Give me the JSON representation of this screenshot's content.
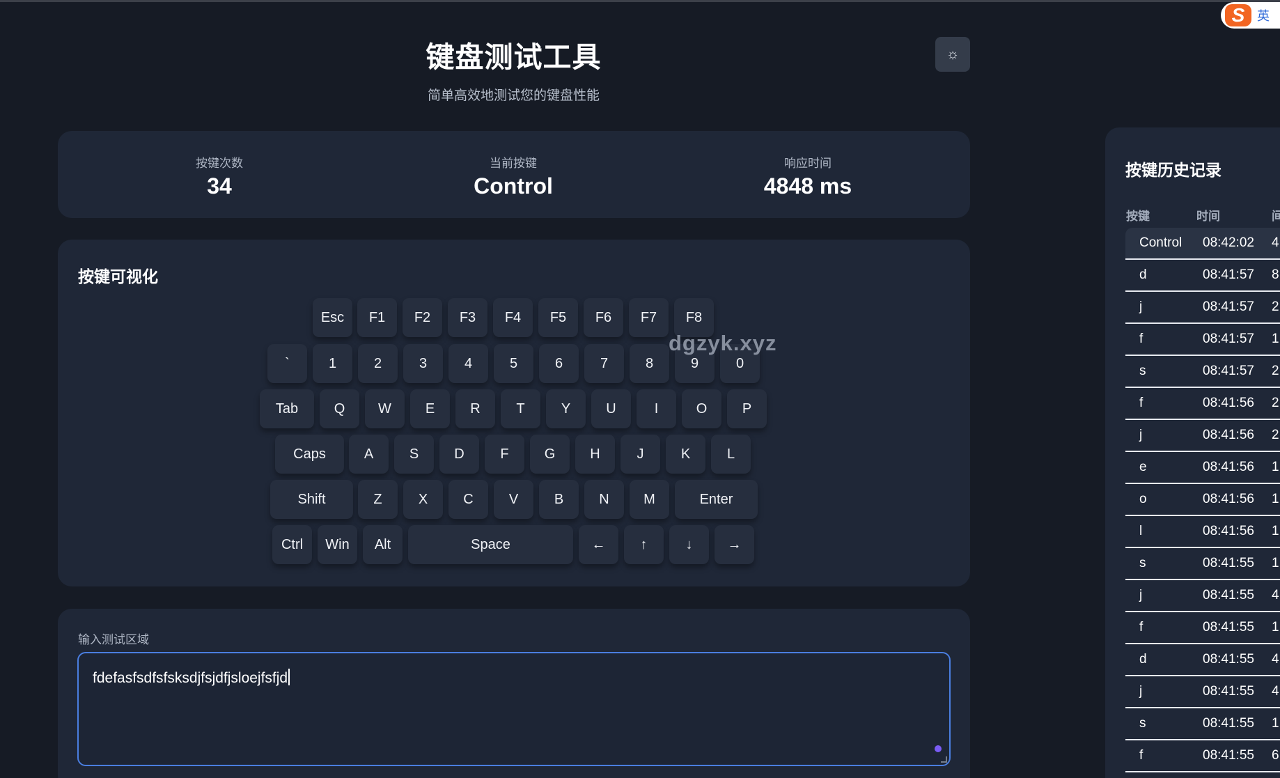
{
  "app": {
    "title": "键盘测试工具",
    "subtitle": "简单高效地测试您的键盘性能",
    "theme_toggle_icon": "☼"
  },
  "ime": {
    "logo": "S",
    "lang": "英"
  },
  "watermark": "dgzyk.xyz",
  "stats": [
    {
      "label": "按键次数",
      "value": "34"
    },
    {
      "label": "当前按键",
      "value": "Control"
    },
    {
      "label": "响应时间",
      "value": "4848 ms"
    }
  ],
  "keyboard": {
    "title": "按键可视化",
    "keys": [
      "Esc",
      "F1",
      "F2",
      "F3",
      "F4",
      "F5",
      "F6",
      "F7",
      "F8",
      "`",
      "1",
      "2",
      "3",
      "4",
      "5",
      "6",
      "7",
      "8",
      "9",
      "0",
      "Tab",
      "Q",
      "W",
      "E",
      "R",
      "T",
      "Y",
      "U",
      "I",
      "O",
      "P",
      "Caps",
      "A",
      "S",
      "D",
      "F",
      "G",
      "H",
      "J",
      "K",
      "L",
      "Shift",
      "Z",
      "X",
      "C",
      "V",
      "B",
      "N",
      "M",
      "Enter",
      "Ctrl",
      "Win",
      "Alt",
      "Space",
      "←",
      "↑",
      "↓",
      "→"
    ]
  },
  "input": {
    "label": "输入测试区域",
    "value": "fdefasfsdfsfsksdjfsjdfjsloejfsfjd"
  },
  "history": {
    "title": "按键历史记录",
    "columns": [
      "按键",
      "时间",
      "间"
    ],
    "rows": [
      {
        "key": "Control",
        "time": "08:42:02",
        "ms": "4"
      },
      {
        "key": "d",
        "time": "08:41:57",
        "ms": "8"
      },
      {
        "key": "j",
        "time": "08:41:57",
        "ms": "2"
      },
      {
        "key": "f",
        "time": "08:41:57",
        "ms": "1"
      },
      {
        "key": "s",
        "time": "08:41:57",
        "ms": "2"
      },
      {
        "key": "f",
        "time": "08:41:56",
        "ms": "2"
      },
      {
        "key": "j",
        "time": "08:41:56",
        "ms": "2"
      },
      {
        "key": "e",
        "time": "08:41:56",
        "ms": "1"
      },
      {
        "key": "o",
        "time": "08:41:56",
        "ms": "1"
      },
      {
        "key": "l",
        "time": "08:41:56",
        "ms": "1"
      },
      {
        "key": "s",
        "time": "08:41:55",
        "ms": "1"
      },
      {
        "key": "j",
        "time": "08:41:55",
        "ms": "4"
      },
      {
        "key": "f",
        "time": "08:41:55",
        "ms": "1"
      },
      {
        "key": "d",
        "time": "08:41:55",
        "ms": "4"
      },
      {
        "key": "j",
        "time": "08:41:55",
        "ms": "4"
      },
      {
        "key": "s",
        "time": "08:41:55",
        "ms": "1"
      },
      {
        "key": "f",
        "time": "08:41:55",
        "ms": "6"
      }
    ]
  }
}
